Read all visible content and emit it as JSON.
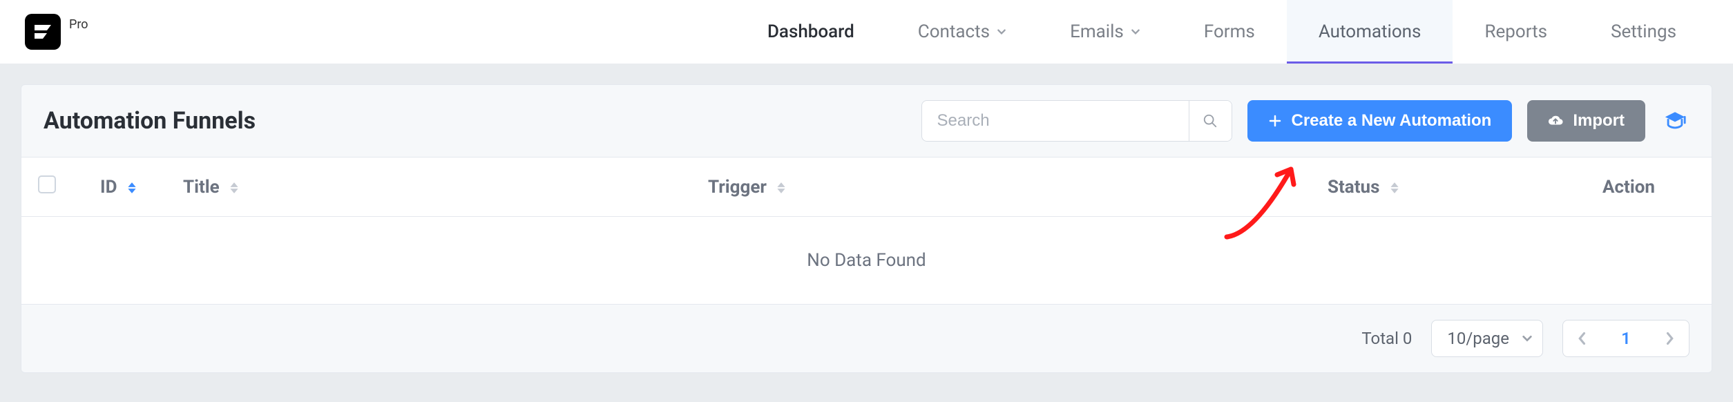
{
  "brand": {
    "tier": "Pro"
  },
  "nav": {
    "dashboard": "Dashboard",
    "contacts": "Contacts",
    "emails": "Emails",
    "forms": "Forms",
    "automations": "Automations",
    "reports": "Reports",
    "settings": "Settings"
  },
  "panel": {
    "title": "Automation Funnels",
    "search_placeholder": "Search",
    "create_label": "Create a New Automation",
    "import_label": "Import"
  },
  "table": {
    "columns": {
      "id": "ID",
      "title": "Title",
      "trigger": "Trigger",
      "status": "Status",
      "action": "Action"
    },
    "empty_message": "No Data Found"
  },
  "pagination": {
    "total_label": "Total 0",
    "page_size_label": "10/page",
    "current_page": "1"
  },
  "colors": {
    "accent_blue": "#3b8cff",
    "accent_purple": "#6b5ce7",
    "gray_button": "#7d8590"
  }
}
